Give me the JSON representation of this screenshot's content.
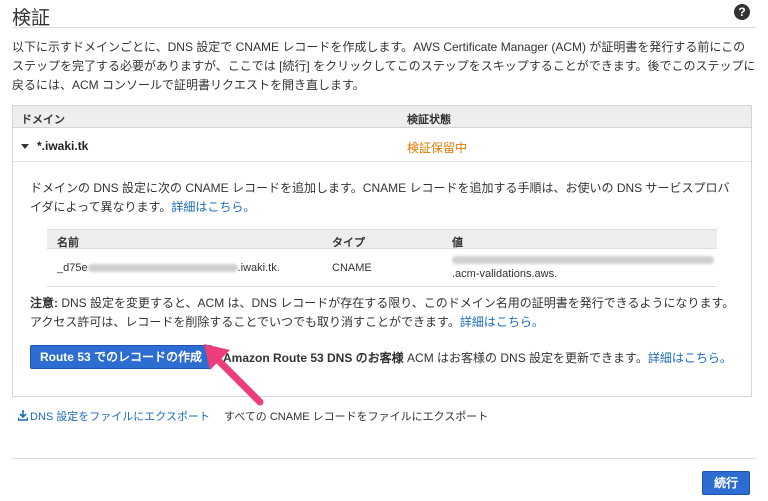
{
  "header": {
    "title": "検証",
    "help_icon": "question-circle-icon"
  },
  "intro": {
    "text": "以下に示すドメインごとに、DNS 設定で CNAME レコードを作成します。AWS Certificate Manager (ACM) が証明書を発行する前にこのステップを完了する必要がありますが、ここでは [続行] をクリックしてこのステップをスキップすることができます。後でこのステップに戻るには、ACM コンソールで証明書リクエストを開き直します。"
  },
  "domain_table": {
    "col_domain": "ドメイン",
    "col_status": "検証状態",
    "domain": "*.iwaki.tk",
    "status": "検証保留中",
    "status_color": "#e07b00"
  },
  "details": {
    "desc_text": "ドメインの DNS 設定に次の CNAME レコードを追加します。CNAME レコードを追加する手順は、お使いの DNS サービスプロバイダによって異なります。",
    "desc_link": "詳細はこちら。",
    "record": {
      "col_name": "名前",
      "col_type": "タイプ",
      "col_value": "値",
      "name_prefix": "_d75e",
      "name_suffix": ".iwaki.tk.",
      "type": "CNAME",
      "value_suffix": ".acm-validations.aws."
    },
    "note_label": "注意:",
    "note_text": " DNS 設定を変更すると、ACM は、DNS レコードが存在する限り、このドメイン名用の証明書を発行できるようになります。アクセス許可は、レコードを削除することでいつでも取り消すことができます。",
    "note_link": "詳細はこちら。",
    "route53_button": "Route 53 でのレコードの作成",
    "route53_bold": "Amazon Route 53 DNS のお客様",
    "route53_text": " ACM はお客様の DNS 設定を更新できます。",
    "route53_link": "詳細はこちら。"
  },
  "export": {
    "link": "DNS 設定をファイルにエクスポート",
    "desc": "すべての CNAME レコードをファイルにエクスポート"
  },
  "footer": {
    "continue_button": "続行"
  },
  "colors": {
    "accent": "#2d6cd0",
    "link": "#1a6bbf",
    "annotation_arrow": "#ee3d7c"
  }
}
